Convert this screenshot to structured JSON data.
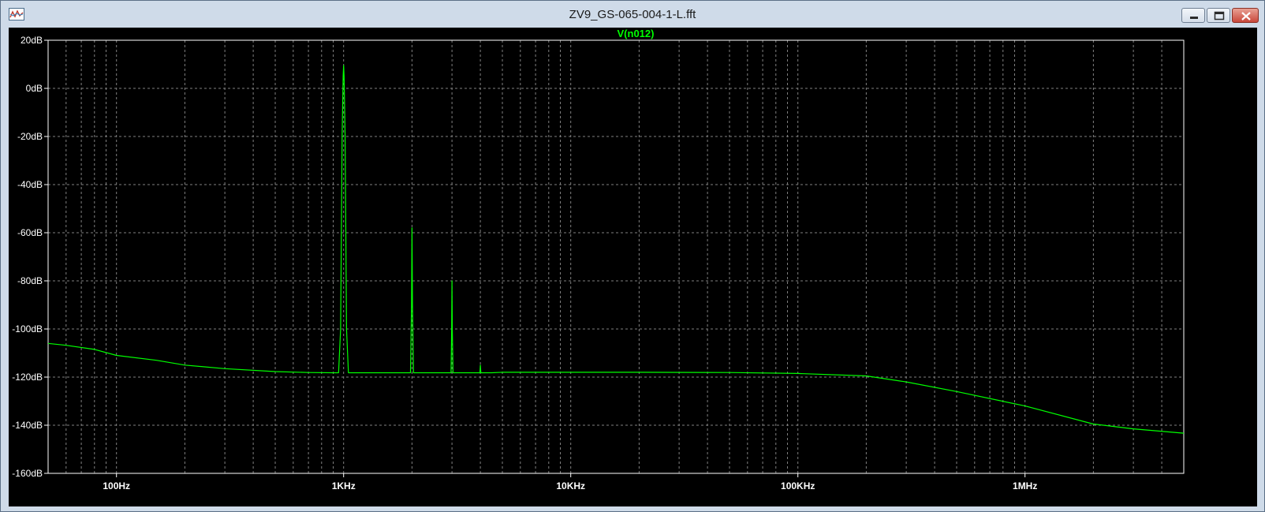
{
  "window": {
    "title": "ZV9_GS-065-004-1-L.fft",
    "icon": "waveform-app-icon",
    "controls": [
      "minimize-icon",
      "maximize-icon",
      "close-icon"
    ]
  },
  "colors": {
    "background": "#000000",
    "trace": "#00ff00",
    "grid": "#808080",
    "axis_text": "#ffffff",
    "trace_label": "#00ff00"
  },
  "chart_data": {
    "type": "line",
    "title": "V(n012)",
    "xscale": "log",
    "xlim": [
      50,
      5000000
    ],
    "ylim": [
      -160,
      20
    ],
    "grid": true,
    "yticks": [
      20,
      0,
      -20,
      -40,
      -60,
      -80,
      -100,
      -120,
      -140,
      -160
    ],
    "ytick_labels": [
      "20dB",
      "0dB",
      "-20dB",
      "-40dB",
      "-60dB",
      "-80dB",
      "-100dB",
      "-120dB",
      "-140dB",
      "-160dB"
    ],
    "xticks": [
      100,
      1000,
      10000,
      100000,
      1000000
    ],
    "xtick_labels": [
      "100Hz",
      "1KHz",
      "10KHz",
      "100KHz",
      "1MHz"
    ],
    "series": [
      {
        "name": "V(n012)",
        "x": [
          50,
          60,
          80,
          100,
          150,
          200,
          300,
          500,
          700,
          900,
          950,
          970,
          985,
          995,
          1000,
          1005,
          1015,
          1030,
          1050,
          1100,
          1500,
          1900,
          1970,
          1990,
          2000,
          2010,
          2030,
          2100,
          2500,
          2900,
          2970,
          2990,
          3000,
          3010,
          3030,
          3100,
          3500,
          3900,
          3980,
          4000,
          4020,
          4100,
          4500,
          5000,
          10000,
          20000,
          50000,
          100000,
          200000,
          300000,
          500000,
          1000000,
          2000000,
          3000000,
          5000000
        ],
        "y": [
          -106,
          -106.8,
          -108.5,
          -111,
          -113,
          -115,
          -116.5,
          -117.7,
          -118.1,
          -118.2,
          -118.2,
          -100,
          -20,
          5,
          9.5,
          5,
          -20,
          -100,
          -118.2,
          -118.2,
          -118.2,
          -118.2,
          -118.2,
          -90,
          -58,
          -90,
          -118.2,
          -118.2,
          -118.2,
          -118.2,
          -118.2,
          -100,
          -80,
          -100,
          -118.2,
          -118.2,
          -118.2,
          -118.2,
          -118.2,
          -115,
          -118.2,
          -118.2,
          -118.2,
          -118,
          -118,
          -118,
          -118.1,
          -118.5,
          -119.5,
          -122,
          -126,
          -132,
          -139.5,
          -141.5,
          -143.3
        ]
      }
    ]
  }
}
